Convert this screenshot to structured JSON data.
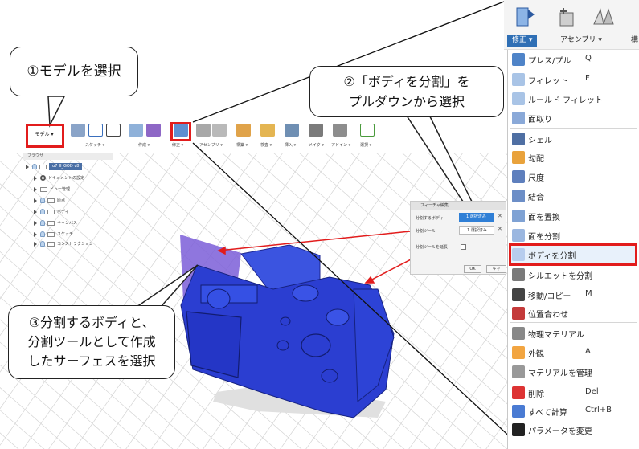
{
  "callouts": {
    "step1": "①モデルを選択",
    "step2_line1": "②「ボディを分割」を",
    "step2_line2": "プルダウンから選択",
    "step3_line1": "③分割するボディと、",
    "step3_line2": "分割ツールとして作成",
    "step3_line3": "したサーフェスを選択"
  },
  "mini_toolbar": {
    "model": "モデル ▾",
    "groups": [
      "スケッチ ▾",
      "作成 ▾",
      "修正 ▾",
      "アセンブリ ▾",
      "構築 ▾",
      "検査 ▾",
      "挿入 ▾",
      "メイク ▾",
      "アドイン ▾",
      "選択 ▾"
    ]
  },
  "browser": {
    "title": "ブラウザ",
    "document": "α7 Ⅲ_GOD v8",
    "items": [
      "ドキュメントの設定",
      "ビュー管理",
      "原点",
      "ボディ",
      "キャンバス",
      "スケッチ",
      "コンストラクション"
    ]
  },
  "dialog": {
    "title": "フィーチャ編集",
    "row1_label": "分割するボディ",
    "row1_value": "1 選択済み",
    "row2_label": "分割ツール",
    "row2_value": "1 選択済み",
    "row3_label": "分割ツールを延長",
    "ok": "OK",
    "cancel": "キャ"
  },
  "top_toolbar": {
    "modify": "修正 ▾",
    "assembly": "アセンブリ ▾",
    "partial": "構"
  },
  "menu": {
    "items": [
      {
        "label": "プレス/プル",
        "key": "Q",
        "icon": "press-pull-icon"
      },
      {
        "label": "フィレット",
        "key": "F",
        "icon": "fillet-icon"
      },
      {
        "label": "ルールド フィレット",
        "key": "",
        "icon": "rule-fillet-icon"
      },
      {
        "label": "面取り",
        "key": "",
        "icon": "chamfer-icon"
      },
      {
        "label": "シェル",
        "key": "",
        "icon": "shell-icon"
      },
      {
        "label": "勾配",
        "key": "",
        "icon": "draft-icon"
      },
      {
        "label": "尺度",
        "key": "",
        "icon": "scale-icon"
      },
      {
        "label": "結合",
        "key": "",
        "icon": "combine-icon"
      },
      {
        "label": "面を置換",
        "key": "",
        "icon": "replace-face-icon"
      },
      {
        "label": "面を分割",
        "key": "",
        "icon": "split-face-icon"
      },
      {
        "label": "ボディを分割",
        "key": "",
        "icon": "split-body-icon"
      },
      {
        "label": "シルエットを分割",
        "key": "",
        "icon": "silhouette-split-icon"
      },
      {
        "label": "移動/コピー",
        "key": "M",
        "icon": "move-icon"
      },
      {
        "label": "位置合わせ",
        "key": "",
        "icon": "align-icon"
      },
      {
        "label": "物理マテリアル",
        "key": "",
        "icon": "physical-material-icon"
      },
      {
        "label": "外観",
        "key": "A",
        "icon": "appearance-icon"
      },
      {
        "label": "マテリアルを管理",
        "key": "",
        "icon": "manage-materials-icon"
      },
      {
        "label": "削除",
        "key": "Del",
        "icon": "delete-icon"
      },
      {
        "label": "すべて計算",
        "key": "Ctrl+B",
        "icon": "compute-all-icon"
      },
      {
        "label": "パラメータを変更",
        "key": "",
        "icon": "parameters-icon"
      }
    ]
  },
  "colors": {
    "accent": "#2f6fb5",
    "highlight_red": "#e21c1c",
    "body_blue": "#2f3fd0"
  }
}
